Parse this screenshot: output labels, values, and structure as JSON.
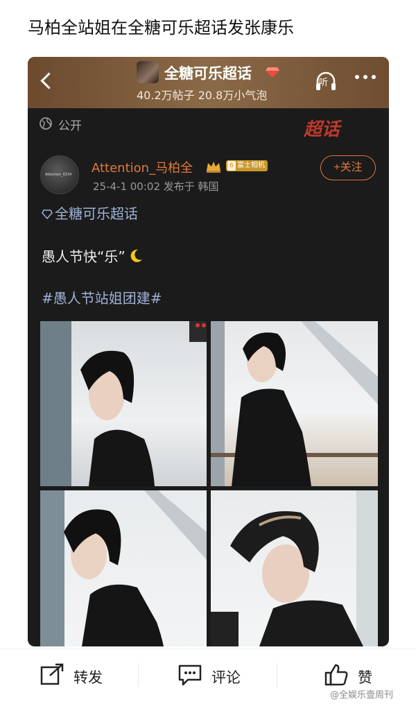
{
  "headline": "马柏全站姐在全糖可乐超话发张康乐",
  "topbar": {
    "title": "全糖可乐超话",
    "stats": "40.2万帖子 20.8万小气泡",
    "listen_label": "听"
  },
  "post": {
    "visibility": "公开",
    "chaohua_mark": "超话",
    "avatar_text": "Attention_0234",
    "username": "Attention_马柏全",
    "badge_level": "6",
    "badge_text": "富士相机",
    "meta": "25-4-1 00:02  发布于 韩国",
    "follow_label": "+关注",
    "topic_link": "全糖可乐超话",
    "text": "愚人节快“乐”",
    "hashtag": "#愚人节站姐团建#"
  },
  "actions": {
    "repost": "转发",
    "comment": "评论",
    "like": "赞"
  },
  "watermark": "@全娱乐壹周刊",
  "colors": {
    "accent": "#e0783a",
    "link": "#9fb2d8",
    "topbar": "#8a6a47",
    "card": "#1b1b1b"
  }
}
